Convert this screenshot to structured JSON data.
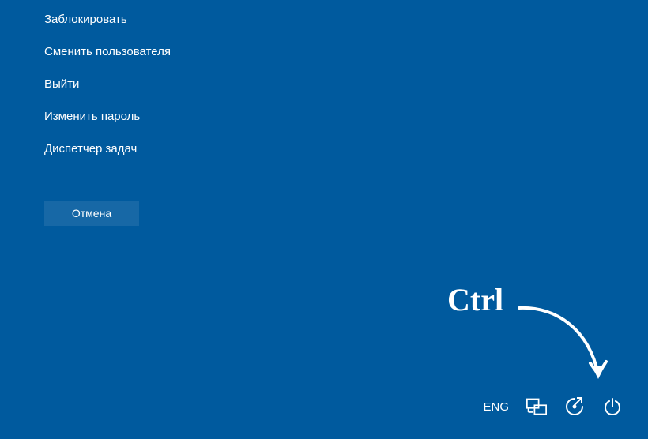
{
  "menu": {
    "items": [
      {
        "label": "Заблокировать"
      },
      {
        "label": "Сменить пользователя"
      },
      {
        "label": "Выйти"
      },
      {
        "label": "Изменить пароль"
      },
      {
        "label": "Диспетчер задач"
      }
    ],
    "cancel_label": "Отмена"
  },
  "annotation": {
    "text": "Ctrl"
  },
  "taskbar": {
    "lang": "ENG"
  }
}
